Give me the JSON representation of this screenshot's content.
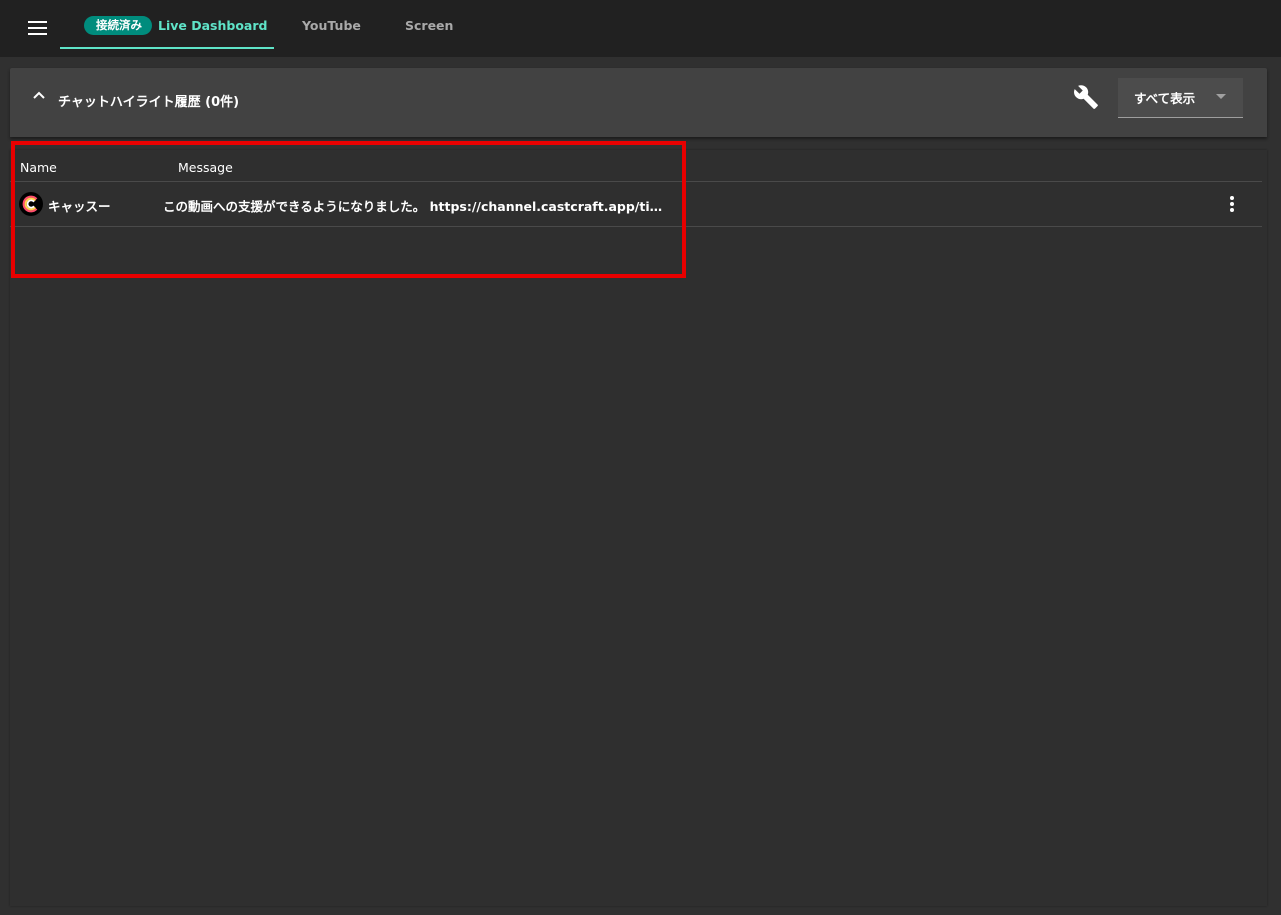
{
  "topbar": {
    "menu_icon": "hamburger-menu-icon",
    "tabs": [
      {
        "badge": "接続済み",
        "label": "Live Dashboard",
        "active": true
      },
      {
        "label": "YouTube",
        "active": false
      },
      {
        "label": "Screen",
        "active": false
      }
    ],
    "accent_color": "#5fe4c8",
    "badge_color": "#008c7d"
  },
  "panel": {
    "title": "チャットハイライト履歴 (0件)",
    "collapse_icon": "chevron-up-icon",
    "settings_icon": "wrench-icon",
    "filter": {
      "selected": "すべて表示"
    }
  },
  "table": {
    "columns": [
      "Name",
      "Message"
    ],
    "rows": [
      {
        "name": "キャッスー",
        "message": "この動画への支援ができるようになりました。 https://channel.castcraft.app/tip/yt/...",
        "avatar_icon": "castcraft-logo-icon",
        "menu_icon": "more-vertical-icon"
      }
    ]
  },
  "annotation": {
    "frame_color": "#e80000"
  }
}
